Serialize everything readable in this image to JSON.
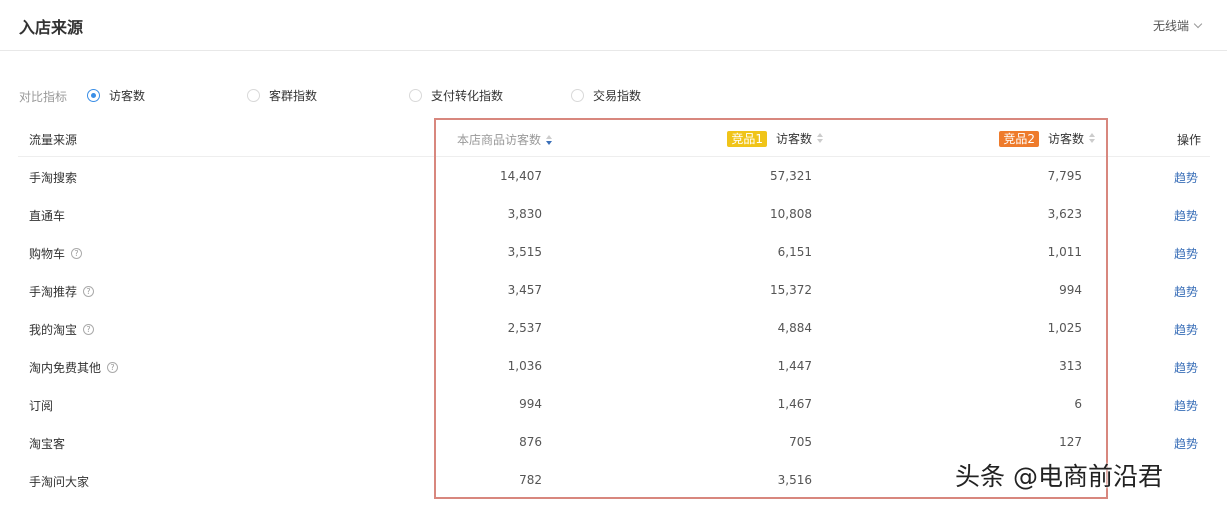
{
  "header": {
    "title": "入店来源",
    "device": "无线端"
  },
  "compare": {
    "label": "对比指标",
    "options": [
      {
        "label": "访客数",
        "selected": true
      },
      {
        "label": "客群指数",
        "selected": false
      },
      {
        "label": "支付转化指数",
        "selected": false
      },
      {
        "label": "交易指数",
        "selected": false
      }
    ]
  },
  "table": {
    "columns": {
      "source": "流量来源",
      "own": "本店商品访客数",
      "competitor1_badge": "竞品1",
      "competitor1_metric": "访客数",
      "competitor2_badge": "竞品2",
      "competitor2_metric": "访客数",
      "action": "操作"
    },
    "rows": [
      {
        "source": "手淘搜索",
        "help": false,
        "own": "14,407",
        "c1": "57,321",
        "c2": "7,795",
        "action": "趋势"
      },
      {
        "source": "直通车",
        "help": false,
        "own": "3,830",
        "c1": "10,808",
        "c2": "3,623",
        "action": "趋势"
      },
      {
        "source": "购物车",
        "help": true,
        "own": "3,515",
        "c1": "6,151",
        "c2": "1,011",
        "action": "趋势"
      },
      {
        "source": "手淘推荐",
        "help": true,
        "own": "3,457",
        "c1": "15,372",
        "c2": "994",
        "action": "趋势"
      },
      {
        "source": "我的淘宝",
        "help": true,
        "own": "2,537",
        "c1": "4,884",
        "c2": "1,025",
        "action": "趋势"
      },
      {
        "source": "淘内免费其他",
        "help": true,
        "own": "1,036",
        "c1": "1,447",
        "c2": "313",
        "action": "趋势"
      },
      {
        "source": "订阅",
        "help": false,
        "own": "994",
        "c1": "1,467",
        "c2": "6",
        "action": "趋势"
      },
      {
        "source": "淘宝客",
        "help": false,
        "own": "876",
        "c1": "705",
        "c2": "127",
        "action": "趋势"
      },
      {
        "source": "手淘问大家",
        "help": false,
        "own": "782",
        "c1": "3,516",
        "c2": "",
        "action": ""
      }
    ]
  },
  "colors": {
    "accent": "#3a8ee6",
    "link": "#3a6fb8",
    "badge1": "#f0c419",
    "badge2": "#ee7b2c",
    "highlight_border": "#d8877e"
  },
  "watermark": "头条 @电商前沿君"
}
